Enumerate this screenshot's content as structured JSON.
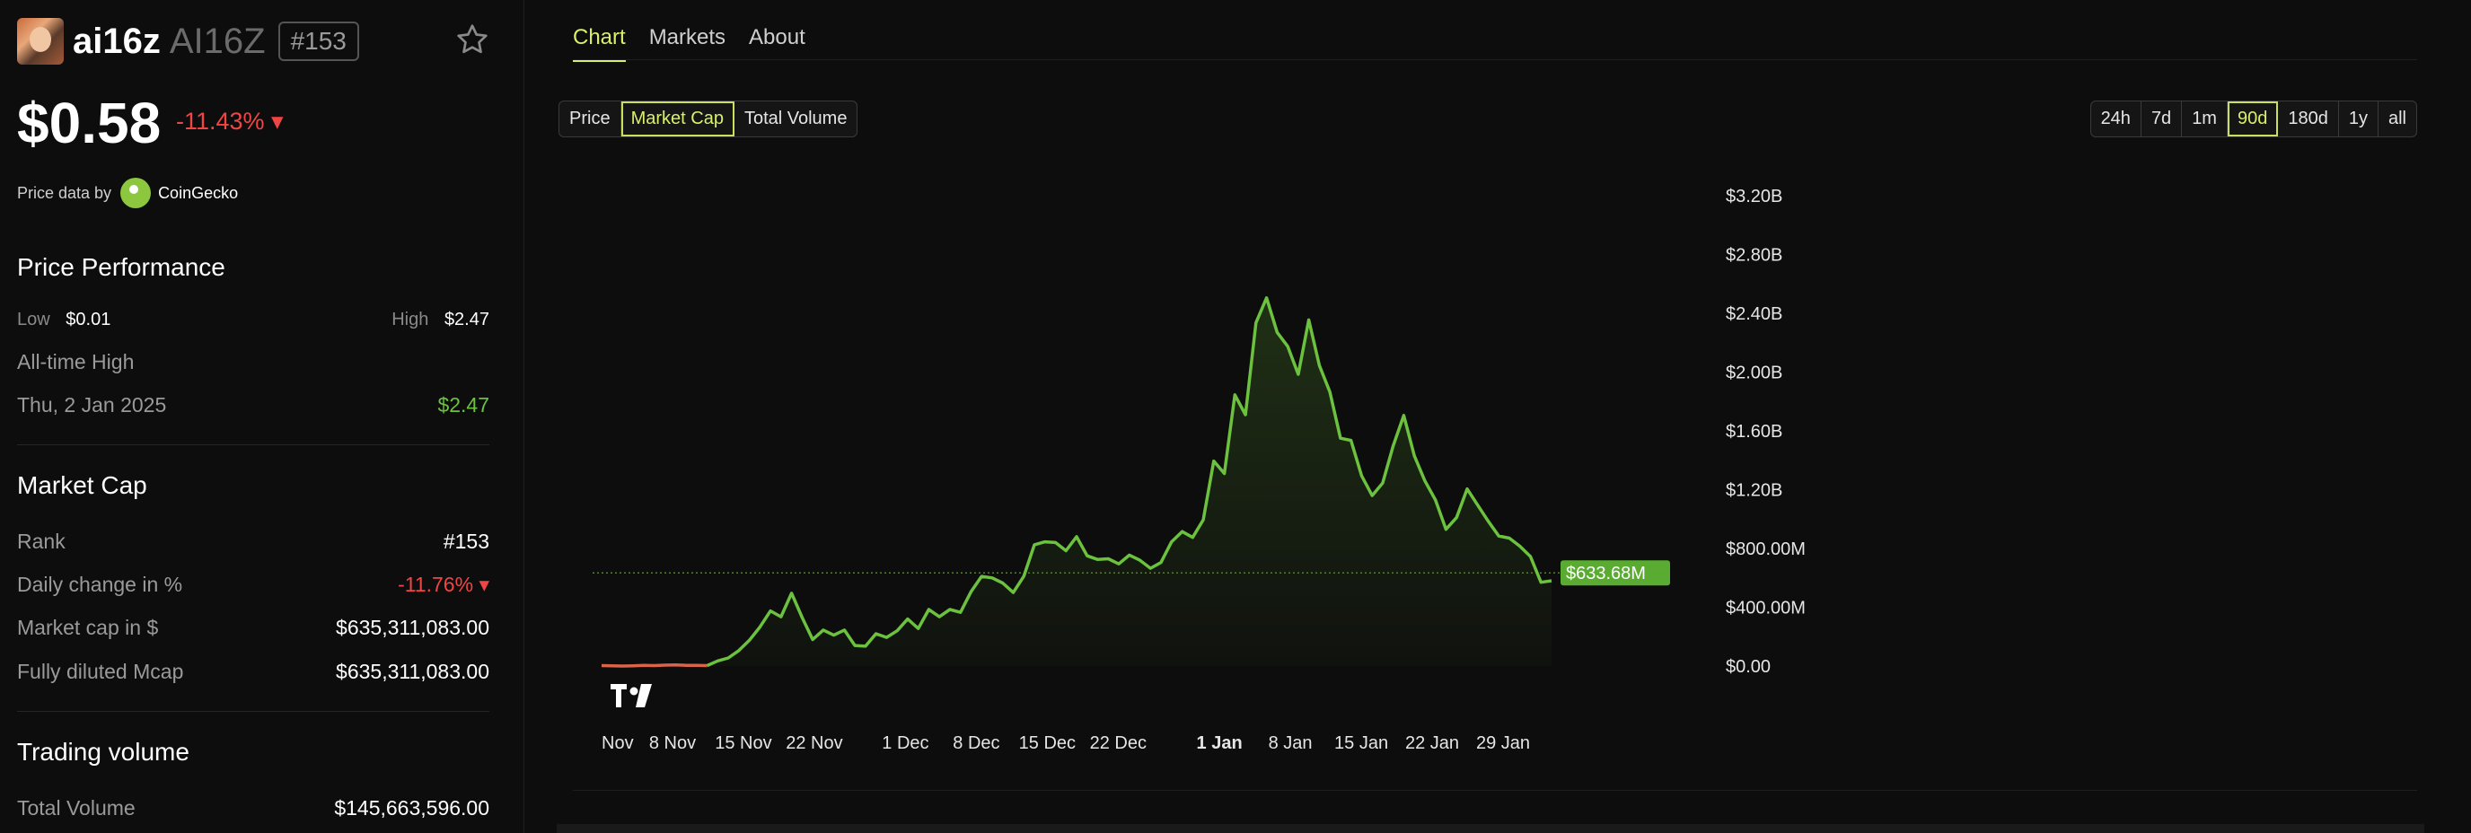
{
  "token": {
    "name": "ai16z",
    "symbol": "AI16Z",
    "rank_badge": "#153"
  },
  "price": {
    "value": "$0.58",
    "change": "-11.43% ▾",
    "source_label": "Price data by",
    "source_name": "CoinGecko"
  },
  "performance": {
    "title": "Price Performance",
    "low_label": "Low",
    "low_value": "$0.01",
    "high_label": "High",
    "high_value": "$2.47",
    "ath_label": "All-time High",
    "ath_date": "Thu, 2 Jan 2025",
    "ath_value": "$2.47"
  },
  "market_cap": {
    "title": "Market Cap",
    "rows": [
      {
        "label": "Rank",
        "value": "#153"
      },
      {
        "label": "Daily change in %",
        "value": "-11.76% ▾"
      },
      {
        "label": "Market cap in $",
        "value": "$635,311,083.00"
      },
      {
        "label": "Fully diluted Mcap",
        "value": "$635,311,083.00"
      }
    ]
  },
  "trading_volume": {
    "title": "Trading volume",
    "rows": [
      {
        "label": "Total Volume",
        "value": "$145,663,596.00"
      }
    ]
  },
  "tabs": [
    "Chart",
    "Markets",
    "About"
  ],
  "metric_buttons": [
    "Price",
    "Market Cap",
    "Total Volume"
  ],
  "range_buttons": [
    "24h",
    "7d",
    "1m",
    "90d",
    "180d",
    "1y",
    "all"
  ],
  "colors": {
    "accent": "#d8f06b",
    "up": "#6cc13f",
    "down": "#f04545"
  },
  "icons": [
    "star-icon",
    "coingecko-logo",
    "tradingview-logo"
  ],
  "chart_data": {
    "type": "area",
    "series_label": "Market Cap",
    "y_ticks": [
      "$3.20B",
      "$2.80B",
      "$2.40B",
      "$2.00B",
      "$1.60B",
      "$1.20B",
      "$800.00M",
      "$400.00M",
      "$0.00"
    ],
    "y_tick_values": [
      3200,
      2800,
      2400,
      2000,
      1600,
      1200,
      800,
      400,
      0
    ],
    "ylim": [
      0,
      3200
    ],
    "x_ticks": [
      "Nov",
      "8 Nov",
      "15 Nov",
      "22 Nov",
      "1 Dec",
      "8 Dec",
      "15 Dec",
      "22 Dec",
      "1 Jan",
      "8 Jan",
      "15 Jan",
      "22 Jan",
      "29 Jan"
    ],
    "x_tick_days": [
      0,
      7,
      14,
      21,
      30,
      37,
      44,
      51,
      61,
      68,
      75,
      82,
      89
    ],
    "current_value_label": "$633.68M",
    "current_value": 633.68,
    "values_musd": [
      3,
      1,
      0,
      2,
      4,
      3,
      6,
      8,
      5,
      4,
      3,
      35,
      55,
      105,
      175,
      265,
      375,
      335,
      495,
      330,
      180,
      245,
      210,
      245,
      140,
      135,
      220,
      195,
      240,
      320,
      255,
      385,
      335,
      385,
      365,
      505,
      610,
      600,
      565,
      500,
      610,
      825,
      845,
      840,
      785,
      880,
      750,
      725,
      730,
      695,
      755,
      720,
      665,
      705,
      845,
      915,
      875,
      995,
      1395,
      1310,
      1845,
      1710,
      2335,
      2505,
      2270,
      2175,
      1985,
      2355,
      2045,
      1865,
      1550,
      1535,
      1295,
      1160,
      1245,
      1500,
      1705,
      1430,
      1260,
      1130,
      930,
      1010,
      1205,
      1095,
      985,
      885,
      870,
      815,
      745,
      570,
      580
    ]
  }
}
